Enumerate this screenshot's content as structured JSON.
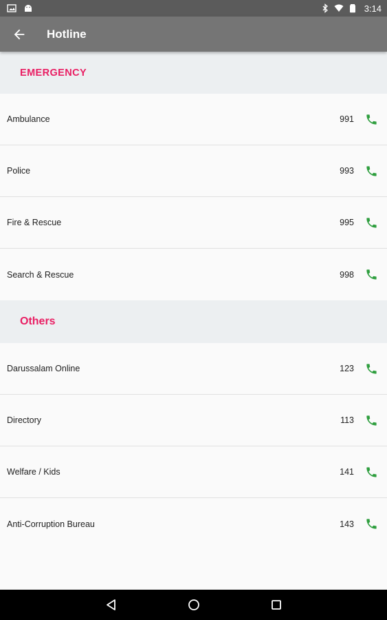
{
  "status_bar": {
    "time": "3:14",
    "left_icons": [
      "image-icon",
      "android-icon"
    ],
    "right_icons": [
      "bluetooth-icon",
      "wifi-icon",
      "battery-icon"
    ]
  },
  "app_bar": {
    "title": "Hotline",
    "back_icon": "arrow-back-icon"
  },
  "sections": {
    "emergency": {
      "title": "EMERGENCY",
      "items": [
        {
          "label": "Ambulance",
          "number": "991"
        },
        {
          "label": "Police",
          "number": "993"
        },
        {
          "label": "Fire & Rescue",
          "number": "995"
        },
        {
          "label": "Search & Rescue",
          "number": "998"
        }
      ]
    },
    "others": {
      "title": "Others",
      "items": [
        {
          "label": "Darussalam Online",
          "number": "123"
        },
        {
          "label": "Directory",
          "number": "113"
        },
        {
          "label": "Welfare / Kids",
          "number": "141"
        },
        {
          "label": "Anti-Corruption Bureau",
          "number": "143"
        }
      ]
    }
  },
  "nav_bar": {
    "buttons": [
      "back-triangle-icon",
      "home-circle-icon",
      "recents-square-icon"
    ]
  },
  "colors": {
    "accent": "#e91e63",
    "call_icon": "#2e9e3e",
    "app_bar": "#757575",
    "status_bar": "#5b5b5b",
    "section_bg": "#eceff1"
  }
}
